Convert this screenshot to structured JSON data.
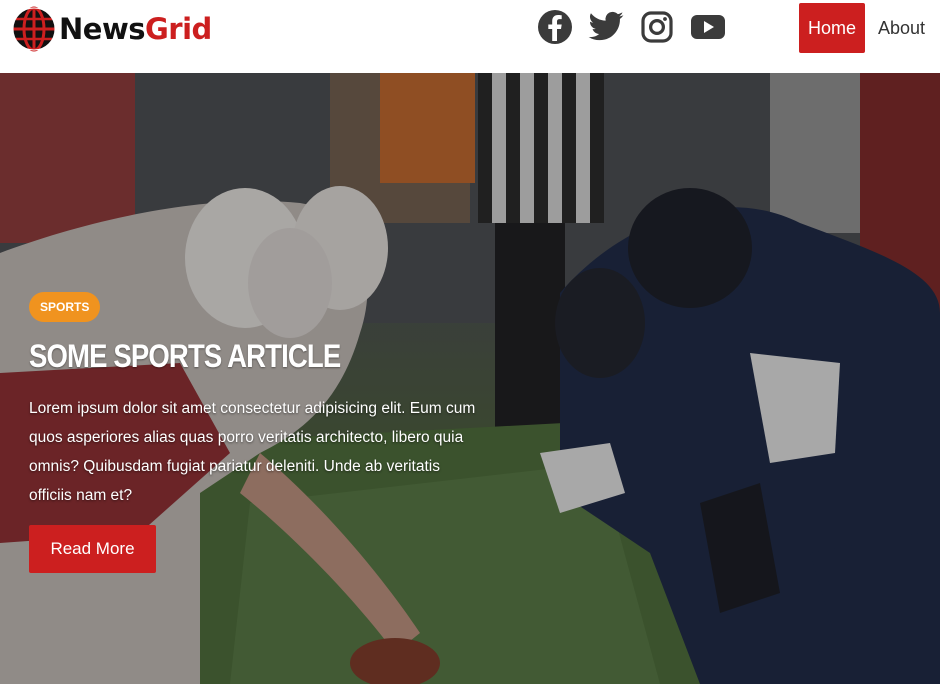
{
  "brand": {
    "part1": "News",
    "part2": "Grid",
    "icon": "globe-icon"
  },
  "social": [
    {
      "name": "facebook-icon"
    },
    {
      "name": "twitter-icon"
    },
    {
      "name": "instagram-icon"
    },
    {
      "name": "youtube-icon"
    }
  ],
  "nav": {
    "home": "Home",
    "about": "About"
  },
  "hero": {
    "category": "SPORTS",
    "title": "SOME SPORTS ARTICLE",
    "excerpt": "Lorem ipsum dolor sit amet consectetur adipisicing elit. Eum cum quos asperiores alias quas porro veritatis architecto, libero quia omnis? Quibusdam fugiat pariatur deleniti. Unde ab veritatis officiis nam et?",
    "cta": "Read More",
    "image": "football-line-of-scrimmage-photo"
  },
  "colors": {
    "accent": "#cc1f1f",
    "badge": "#f0931f",
    "nav_text": "#333333"
  }
}
